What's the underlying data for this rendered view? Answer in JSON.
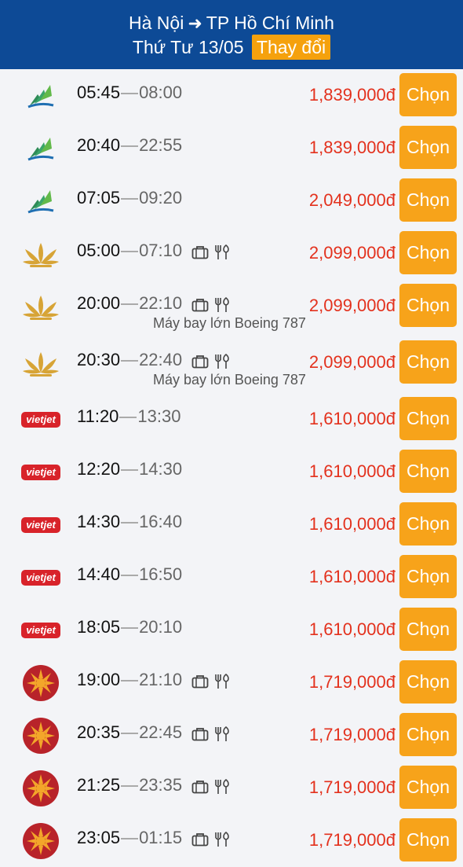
{
  "header": {
    "from": "Hà Nội",
    "to": "TP Hồ Chí Minh",
    "date": "Thứ Tư 13/05",
    "change_label": "Thay đổi"
  },
  "colors": {
    "header_bg": "#0d4a96",
    "accent": "#f7a31a",
    "price": "#e3311d",
    "vietjet": "#d8232a",
    "pacific": "#b8232a",
    "vna": "#d7a436",
    "bamboo": "#2e8b57"
  },
  "select_label": "Chọn",
  "flights": [
    {
      "airline": "bamboo",
      "depart": "05:45",
      "arrive": "08:00",
      "price": "1,839,000đ",
      "amenities": false,
      "note": ""
    },
    {
      "airline": "bamboo",
      "depart": "20:40",
      "arrive": "22:55",
      "price": "1,839,000đ",
      "amenities": false,
      "note": ""
    },
    {
      "airline": "bamboo",
      "depart": "07:05",
      "arrive": "09:20",
      "price": "2,049,000đ",
      "amenities": false,
      "note": ""
    },
    {
      "airline": "vietnam-airlines",
      "depart": "05:00",
      "arrive": "07:10",
      "price": "2,099,000đ",
      "amenities": true,
      "note": ""
    },
    {
      "airline": "vietnam-airlines",
      "depart": "20:00",
      "arrive": "22:10",
      "price": "2,099,000đ",
      "amenities": true,
      "note": "Máy bay lớn Boeing 787"
    },
    {
      "airline": "vietnam-airlines",
      "depart": "20:30",
      "arrive": "22:40",
      "price": "2,099,000đ",
      "amenities": true,
      "note": "Máy bay lớn Boeing 787"
    },
    {
      "airline": "vietjet",
      "depart": "11:20",
      "arrive": "13:30",
      "price": "1,610,000đ",
      "amenities": false,
      "note": ""
    },
    {
      "airline": "vietjet",
      "depart": "12:20",
      "arrive": "14:30",
      "price": "1,610,000đ",
      "amenities": false,
      "note": ""
    },
    {
      "airline": "vietjet",
      "depart": "14:30",
      "arrive": "16:40",
      "price": "1,610,000đ",
      "amenities": false,
      "note": ""
    },
    {
      "airline": "vietjet",
      "depart": "14:40",
      "arrive": "16:50",
      "price": "1,610,000đ",
      "amenities": false,
      "note": ""
    },
    {
      "airline": "vietjet",
      "depart": "18:05",
      "arrive": "20:10",
      "price": "1,610,000đ",
      "amenities": false,
      "note": ""
    },
    {
      "airline": "pacific-airlines",
      "depart": "19:00",
      "arrive": "21:10",
      "price": "1,719,000đ",
      "amenities": true,
      "note": ""
    },
    {
      "airline": "pacific-airlines",
      "depart": "20:35",
      "arrive": "22:45",
      "price": "1,719,000đ",
      "amenities": true,
      "note": ""
    },
    {
      "airline": "pacific-airlines",
      "depart": "21:25",
      "arrive": "23:35",
      "price": "1,719,000đ",
      "amenities": true,
      "note": ""
    },
    {
      "airline": "pacific-airlines",
      "depart": "23:05",
      "arrive": "01:15",
      "price": "1,719,000đ",
      "amenities": true,
      "note": ""
    }
  ],
  "logo_text": {
    "vietjet": "vietjet"
  }
}
